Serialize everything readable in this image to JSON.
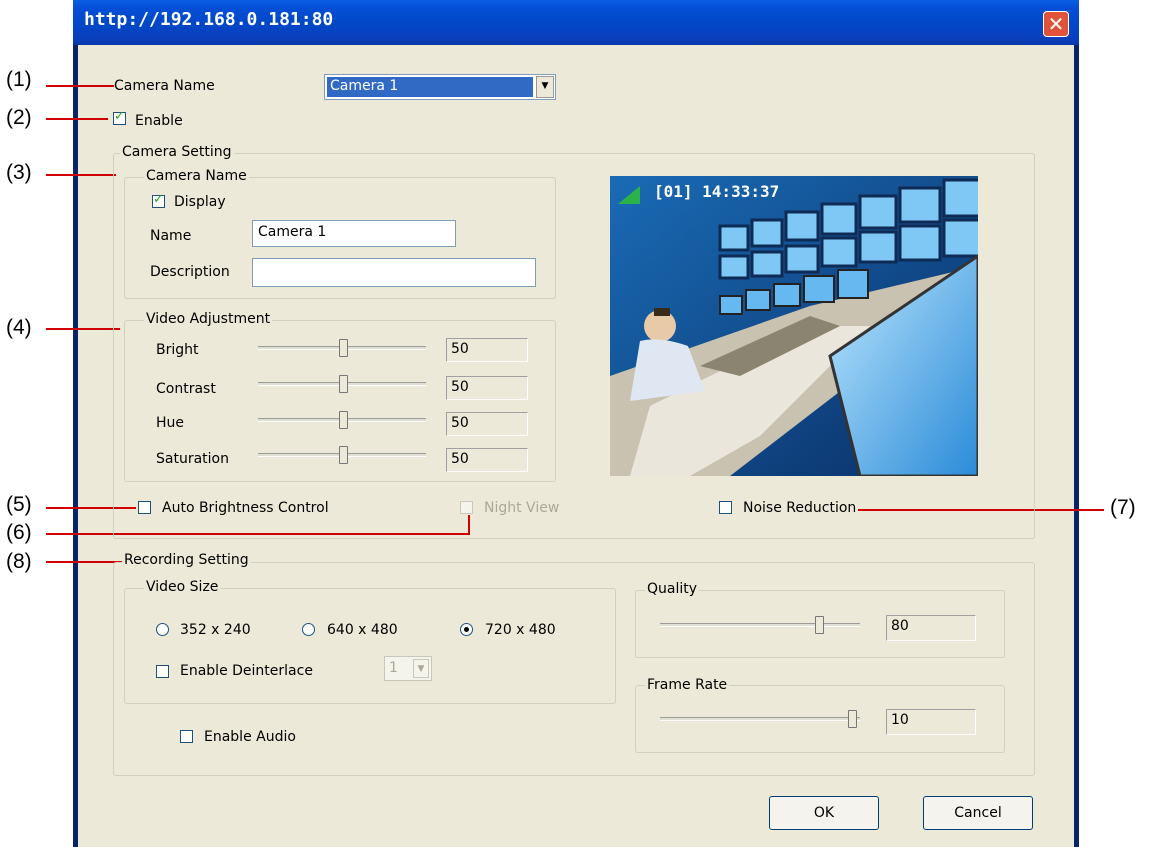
{
  "window": {
    "title": "http://192.168.0.181:80",
    "close_icon": "close-icon"
  },
  "callouts": [
    "(1)",
    "(2)",
    "(3)",
    "(4)",
    "(5)",
    "(6)",
    "(7)",
    "(8)"
  ],
  "camera_name": {
    "label": "Camera Name",
    "value": "Camera 1"
  },
  "enable": {
    "label": "Enable",
    "checked": true
  },
  "camera_setting": {
    "legend": "Camera Setting",
    "camera_name_group": {
      "legend": "Camera Name",
      "display_label": "Display",
      "display_checked": true,
      "name_label": "Name",
      "name_value": "Camera 1",
      "description_label": "Description",
      "description_value": ""
    },
    "video_adjustment": {
      "legend": "Video Adjustment",
      "sliders": [
        {
          "label": "Bright",
          "value": "50"
        },
        {
          "label": "Contrast",
          "value": "50"
        },
        {
          "label": "Hue",
          "value": "50"
        },
        {
          "label": "Saturation",
          "value": "50"
        }
      ]
    },
    "preview_overlay": "[01] 14:33:37",
    "auto_brightness": {
      "label": "Auto Brightness Control",
      "checked": false
    },
    "night_view": {
      "label": "Night View",
      "checked": false,
      "enabled": false
    },
    "noise_reduction": {
      "label": "Noise Reduction",
      "checked": false
    }
  },
  "recording_setting": {
    "legend": "Recording Setting",
    "video_size": {
      "legend": "Video Size",
      "options": [
        "352 x 240",
        "640 x 480",
        "720 x 480"
      ],
      "selected": "720 x 480",
      "deinterlace_label": "Enable Deinterlace",
      "deinterlace_checked": false,
      "deinterlace_value": "1"
    },
    "enable_audio": {
      "label": "Enable Audio",
      "checked": false
    },
    "quality": {
      "legend": "Quality",
      "value": "80"
    },
    "frame_rate": {
      "legend": "Frame Rate",
      "value": "10"
    }
  },
  "buttons": {
    "ok": "OK",
    "cancel": "Cancel"
  }
}
